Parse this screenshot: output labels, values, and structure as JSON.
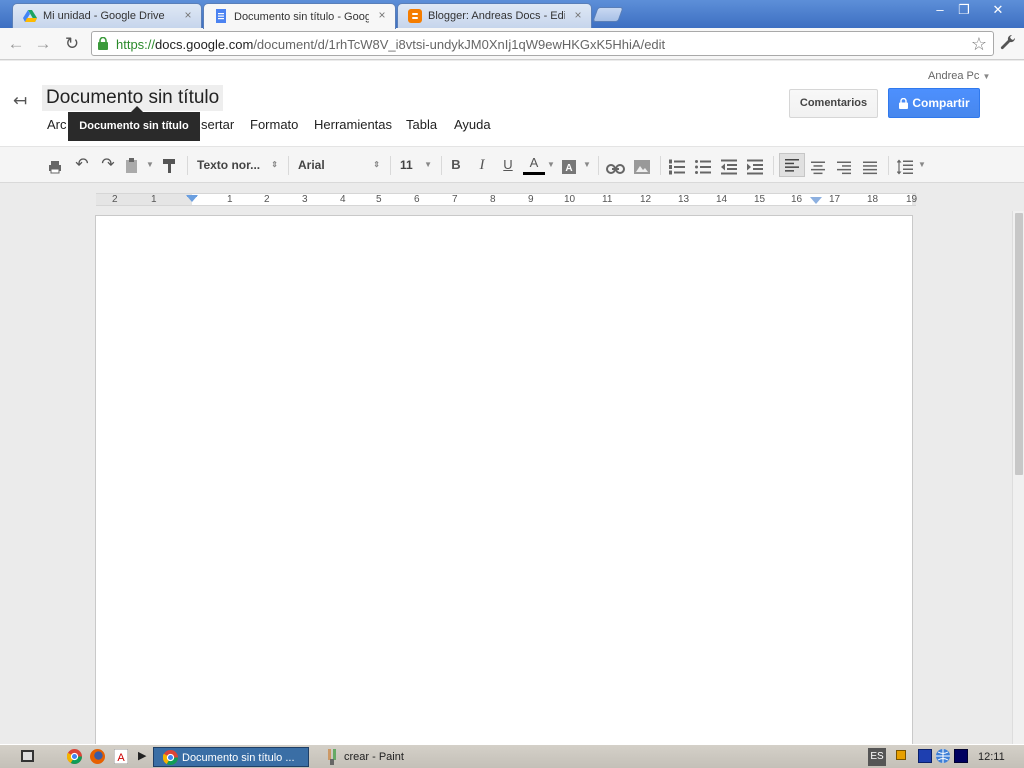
{
  "browser": {
    "tabs": [
      {
        "label": "Mi unidad - Google Drive",
        "icon": "google-drive-icon",
        "active": false
      },
      {
        "label": "Documento sin título - Googl",
        "icon": "docs-icon",
        "active": true
      },
      {
        "label": "Blogger: Andreas Docs - Edit",
        "icon": "blogger-icon",
        "active": false
      }
    ],
    "url": {
      "scheme": "https://",
      "host": "docs.google.com",
      "path": "/document/d/1rhTcW8V_i8vtsi-undykJM0XnIj1qW9ewHKGxK5HhiA/edit"
    },
    "window_controls": {
      "minimize": "–",
      "maximize": "❐",
      "close": "✕"
    }
  },
  "docs": {
    "title": "Documento sin título",
    "account": "Andrea Pc",
    "comments_label": "Comentarios",
    "share_label": "Compartir",
    "tooltip": "Documento sin título",
    "menu": {
      "archivo": "Arc",
      "insertar": "sertar",
      "formato": "Formato",
      "herramientas": "Herramientas",
      "tabla": "Tabla",
      "ayuda": "Ayuda"
    },
    "toolbar": {
      "style": "Texto nor...",
      "font": "Arial",
      "size": "11",
      "bold": "B",
      "italic": "I",
      "underline": "U",
      "text_color": "A",
      "text_color_swatch": "#000000"
    },
    "ruler_labels": [
      "2",
      "1",
      "1",
      "2",
      "3",
      "4",
      "5",
      "6",
      "7",
      "8",
      "9",
      "10",
      "11",
      "12",
      "13",
      "14",
      "15",
      "16",
      "17",
      "18",
      "19"
    ]
  },
  "taskbar": {
    "tasks": [
      {
        "label": "Documento sin título ...",
        "icon": "chrome-icon",
        "active": true
      },
      {
        "label": "crear - Paint",
        "icon": "paint-icon",
        "active": false
      }
    ],
    "language": "ES",
    "clock": "12:11"
  },
  "colors": {
    "share_button": "#4d90fe",
    "tab_strip": "#4a7ecb",
    "taskbar_active": "#3a6ea5"
  }
}
